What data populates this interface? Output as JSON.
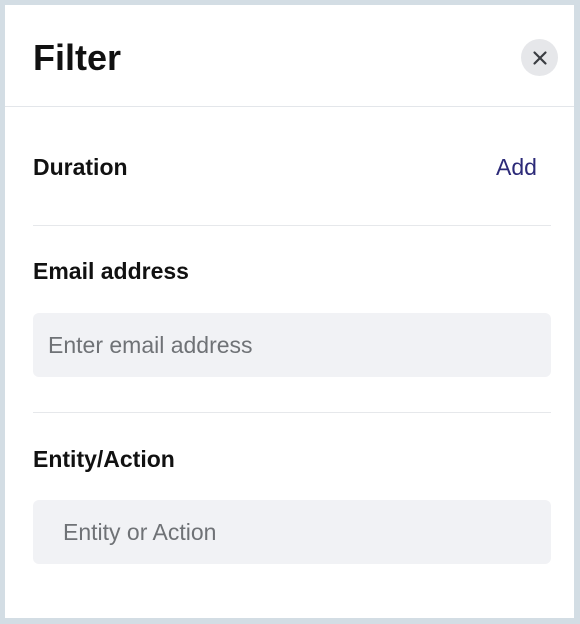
{
  "header": {
    "title": "Filter"
  },
  "duration": {
    "label": "Duration",
    "add_label": "Add"
  },
  "email": {
    "label": "Email address",
    "value": "",
    "placeholder": "Enter email address"
  },
  "entity": {
    "label": "Entity/Action",
    "value": "",
    "placeholder": "Entity or Action"
  },
  "icons": {
    "close": "close-icon"
  },
  "colors": {
    "link": "#2c2a78",
    "field_background": "#f1f2f5",
    "backdrop": "#d3dde4"
  }
}
